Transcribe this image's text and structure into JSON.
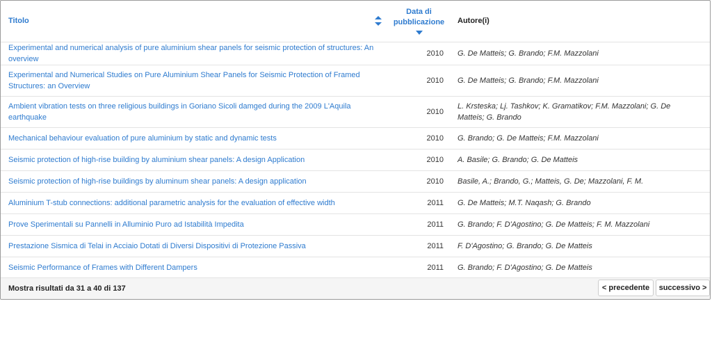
{
  "table": {
    "headers": {
      "title": "Titolo",
      "date": "Data di pubblicazione",
      "author": "Autore(i)"
    },
    "rows": [
      {
        "title": "Experimental and numerical analysis of pure aluminium shear panels for seismic protection of structures: An overview",
        "date": "2010",
        "authors": "G. De Matteis; G. Brando; F.M. Mazzolani"
      },
      {
        "title": "Experimental and Numerical Studies on Pure Aluminium Shear Panels for Seismic Protection of Framed Structures: an Overview",
        "date": "2010",
        "authors": "G. De Matteis; G. Brando; F.M. Mazzolani"
      },
      {
        "title": "Ambient vibration tests on three religious buildings in Goriano Sicoli damged during the 2009 L'Aquila earthquake",
        "date": "2010",
        "authors": "L. Krsteska; Lj. Tashkov; K. Gramatikov; F.M. Mazzolani; G. De Matteis; G. Brando"
      },
      {
        "title": "Mechanical behaviour evaluation of pure aluminium by static and dynamic tests",
        "date": "2010",
        "authors": "G. Brando; G. De Matteis; F.M. Mazzolani"
      },
      {
        "title": "Seismic protection of high-rise building by aluminium shear panels: A design Application",
        "date": "2010",
        "authors": "A. Basile; G. Brando; G. De Matteis"
      },
      {
        "title": "Seismic protection of high-rise buildings by aluminum shear panels: A design application",
        "date": "2010",
        "authors": "Basile, A.; Brando, G.; Matteis, G. De; Mazzolani, F. M."
      },
      {
        "title": "Aluminium T-stub connections: additional parametric analysis for the evaluation of effective width",
        "date": "2011",
        "authors": "G. De Matteis; M.T. Naqash; G. Brando"
      },
      {
        "title": "Prove Sperimentali su Pannelli in Alluminio Puro ad Istabilità Impedita",
        "date": "2011",
        "authors": "G. Brando; F. D'Agostino; G. De Matteis; F. M. Mazzolani"
      },
      {
        "title": "Prestazione Sismica di Telai in Acciaio Dotati di Diversi Dispositivi di Protezione Passiva",
        "date": "2011",
        "authors": "F. D'Agostino; G. Brando; G. De Matteis"
      },
      {
        "title": "Seismic Performance of Frames with Different Dampers",
        "date": "2011",
        "authors": "G. Brando; F. D'Agostino; G. De Matteis"
      }
    ]
  },
  "footer": {
    "summary": "Mostra risultati da 31 a 40 di 137",
    "prev_label": "< precedente",
    "next_label": "successivo >"
  },
  "colors": {
    "link": "#2e7bcf",
    "footer_bg": "#f5f5f5"
  },
  "icons": {
    "title_sort": "sort-both-icon",
    "date_sort": "sort-desc-icon"
  }
}
